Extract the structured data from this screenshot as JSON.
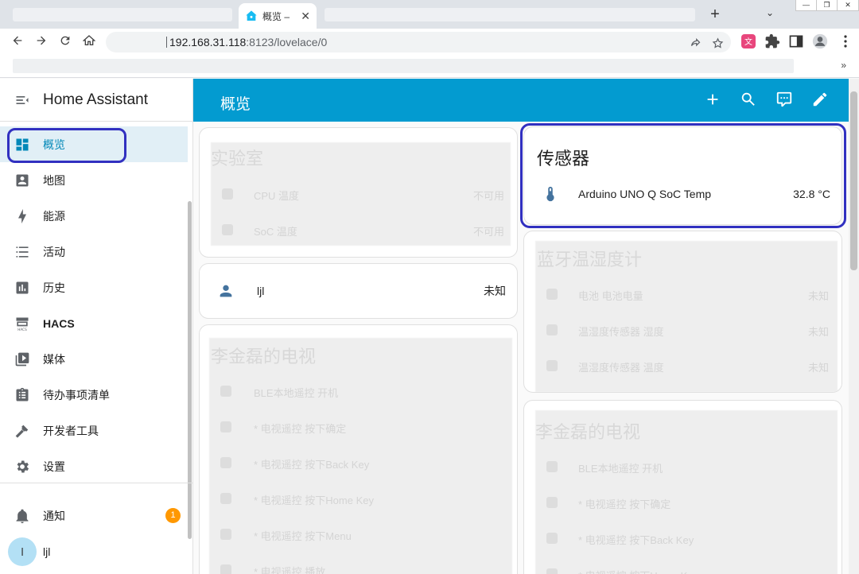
{
  "browser": {
    "tab_title": "概览 –",
    "tab_close": "✕",
    "new_tab": "+",
    "tab_list": "⌄",
    "url_host": "192.168.31.118",
    "url_rest": ":8123/lovelace/0",
    "bookmarks_more": "»",
    "window_controls": [
      "—",
      "❐",
      "✕"
    ]
  },
  "sidebar": {
    "title": "Home Assistant",
    "items": [
      {
        "label": "概览",
        "icon": "view-dashboard-icon",
        "selected": true
      },
      {
        "label": "地图",
        "icon": "map-icon"
      },
      {
        "label": "能源",
        "icon": "lightning-icon"
      },
      {
        "label": "活动",
        "icon": "format-list-icon"
      },
      {
        "label": "历史",
        "icon": "chart-box-icon"
      },
      {
        "label": "HACS",
        "icon": "hacs-icon"
      },
      {
        "label": "媒体",
        "icon": "play-box-icon"
      },
      {
        "label": "待办事项清单",
        "icon": "clipboard-list-icon"
      },
      {
        "label": "开发者工具",
        "icon": "hammer-icon"
      },
      {
        "label": "设置",
        "icon": "cog-icon"
      }
    ],
    "notifications_label": "通知",
    "notifications_count": "1",
    "user_name": "ljl",
    "user_initial": "l"
  },
  "header": {
    "title": "概览"
  },
  "cards": {
    "lab": {
      "title": "实验室",
      "rows": [
        {
          "name": "CPU 温度",
          "state": "不可用"
        },
        {
          "name": "SoC 温度",
          "state": "不可用"
        }
      ]
    },
    "person": {
      "name": "ljl",
      "state": "未知"
    },
    "tv_left": {
      "title": "李金磊的电视",
      "rows": [
        {
          "name": "BLE本地遥控 开机"
        },
        {
          "name": "* 电视遥控 按下确定"
        },
        {
          "name": "* 电视遥控 按下Back Key"
        },
        {
          "name": "* 电视遥控 按下Home Key"
        },
        {
          "name": "* 电视遥控 按下Menu"
        },
        {
          "name": "* 电视遥控 播放"
        }
      ]
    },
    "sensor": {
      "title": "传感器",
      "entity_name": "Arduino UNO Q SoC Temp",
      "entity_state": "32.8 °C"
    },
    "bt": {
      "title": "蓝牙温湿度计",
      "rows": [
        {
          "name": "电池 电池电量",
          "state": "未知"
        },
        {
          "name": "温湿度传感器 湿度",
          "state": "未知"
        },
        {
          "name": "温湿度传感器 温度",
          "state": "未知"
        }
      ]
    },
    "tv_right": {
      "title": "李金磊的电视",
      "rows": [
        {
          "name": "BLE本地遥控 开机"
        },
        {
          "name": "* 电视遥控 按下确定"
        },
        {
          "name": "* 电视遥控 按下Back Key"
        },
        {
          "name": "* 电视遥控 按下Home Key"
        }
      ]
    }
  },
  "colors": {
    "header_bg": "#039bd0",
    "selected_bg": "#e1eff6",
    "selected_fg": "#0288b8",
    "entity_icon": "#44739e",
    "highlight": "#3130c0",
    "badge": "#ff9800"
  }
}
